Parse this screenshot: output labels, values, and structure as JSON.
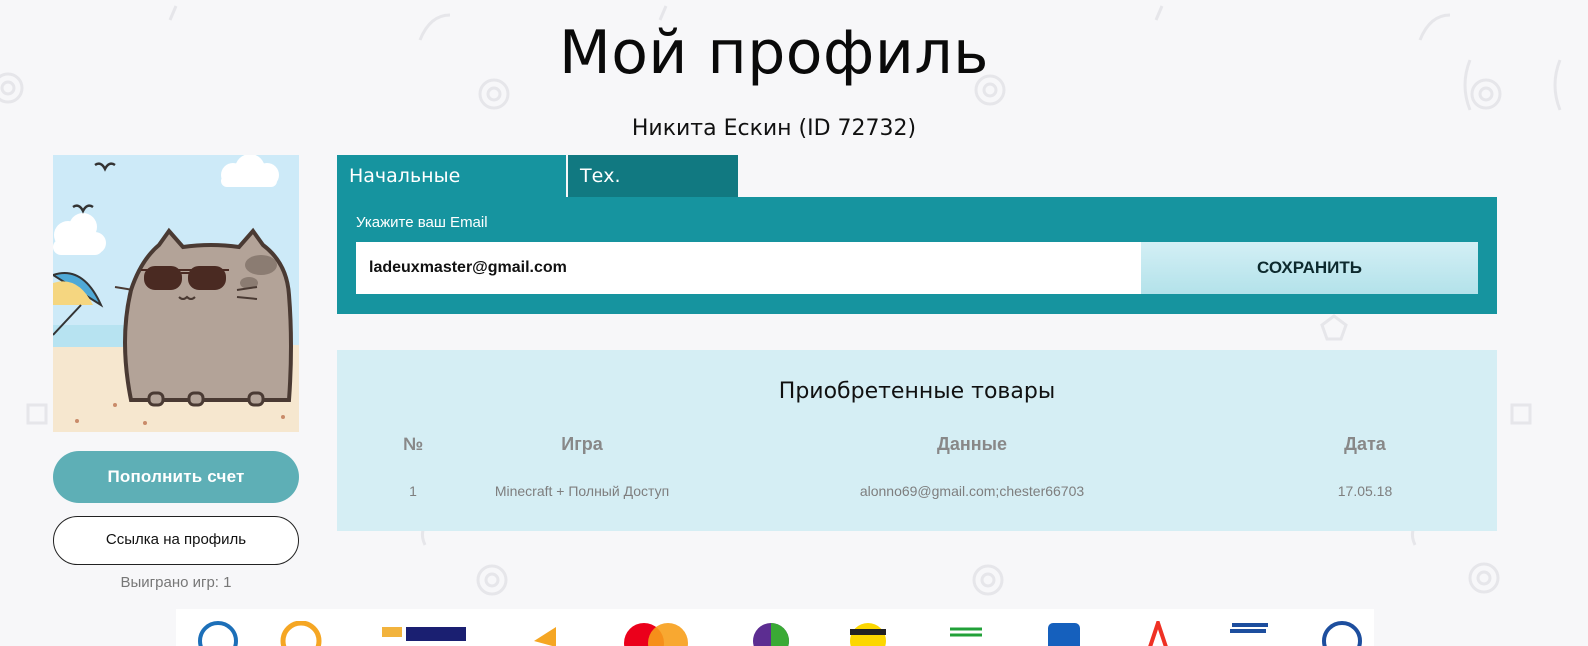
{
  "page_title": "Мой профиль",
  "user_line": "Никита Ескин (ID 72732)",
  "left": {
    "topup_label": "Пополнить счет",
    "profile_link_label": "Ссылка на профиль",
    "games_won": "Выиграно игр: 1"
  },
  "tabs": [
    {
      "label": "Начальные настройки",
      "active": true
    },
    {
      "label": "Тех. поддержка",
      "active": false
    }
  ],
  "email_form": {
    "label": "Укажите ваш Email",
    "value": "ladeuxmaster@gmail.com",
    "save_label": "СОХРАНИТЬ"
  },
  "purchases": {
    "title": "Приобретенные товары",
    "columns": [
      "№",
      "Игра",
      "Данные",
      "Дата"
    ],
    "rows": [
      [
        "1",
        "Minecraft + Полный Доступ",
        "alonno69@gmail.com;chester66703",
        "17.05.18"
      ]
    ]
  },
  "colors": {
    "teal_panel": "#16949f",
    "teal_tab_inactive": "#117981",
    "topup_button": "#5eafb6",
    "purchases_bg": "#d5eef4"
  },
  "payment_icons": [
    "webmoney-icon",
    "qiwi-icon",
    "visa-icon",
    "yandex-money-icon",
    "mastercard-icon",
    "pay-wheel-icon",
    "beeline-icon",
    "sberbank-icon",
    "card-p-icon",
    "alfa-bank-icon",
    "bank-card-icon",
    "globe-pay-icon"
  ]
}
